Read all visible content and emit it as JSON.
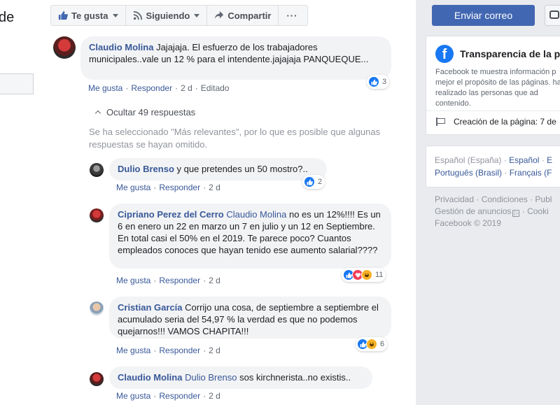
{
  "left": {
    "title_fragment": "de"
  },
  "actions": {
    "like": "Te gusta",
    "follow": "Siguiendo",
    "share": "Compartir",
    "more": "···"
  },
  "header": {
    "send_email": "Enviar correo"
  },
  "comments": [
    {
      "author": "Claudio Molina",
      "mention": "",
      "text": "Jajajaja. El esfuerzo de los trabajadores municipales..vale un 12 % para el intendente.jajajaja PANQUEQUE...",
      "like": "Me gusta",
      "reply": "Responder",
      "time": "2 d",
      "edited": "Editado",
      "reactions": [
        "like"
      ],
      "reaction_count": "3"
    },
    {
      "author": "Dulio Brenso",
      "mention": "",
      "text": "y que pretendes un 50 mostro?..",
      "like": "Me gusta",
      "reply": "Responder",
      "time": "2 d",
      "reactions": [
        "like"
      ],
      "reaction_count": "2"
    },
    {
      "author": "Cipriano Perez del Cerro",
      "mention": "Claudio Molina",
      "text": "no es un 12%!!!! Es un 6 en enero un 22 en marzo un 7 en julio y un 12 en Septiembre. En total casi el 50% en el 2019. Te parece poco? Cuantos empleados conoces que hayan tenido ese aumento salarial????",
      "like": "Me gusta",
      "reply": "Responder",
      "time": "2 d",
      "reactions": [
        "like",
        "love",
        "haha"
      ],
      "reaction_count": "11"
    },
    {
      "author": "Cristian García",
      "mention": "",
      "text": "Corrijo una cosa, de septiembre a septiembre el acumulado seria del 54,97 % la verdad es que no podemos quejarnos!!! VAMOS CHAPITA!!!",
      "like": "Me gusta",
      "reply": "Responder",
      "time": "2 d",
      "reactions": [
        "like",
        "haha"
      ],
      "reaction_count": "6"
    },
    {
      "author": "Claudio Molina",
      "mention": "Dulio Brenso",
      "text": "sos kirchnerista..no existis..",
      "like": "Me gusta",
      "reply": "Responder",
      "time": "2 d",
      "reactions": [],
      "reaction_count": ""
    }
  ],
  "replies": {
    "hide_label": "Ocultar 49 respuestas",
    "notice": "Se ha seleccionado \"Más relevantes\", por lo que es posible que algunas respuestas se hayan omitido."
  },
  "transparency": {
    "title": "Transparencia de la p",
    "description": "Facebook te muestra información p mejor el propósito de las páginas. han realizado las personas que ad contenido.",
    "creation": "Creación de la página: 7 de"
  },
  "languages": {
    "current": "Español (España)",
    "options": [
      "Español",
      "E",
      "Português (Brasil)",
      "Français (F"
    ]
  },
  "footer": {
    "links_row1": [
      "Privacidad",
      "Condiciones",
      "Publ"
    ],
    "links_row2": [
      "Gestión de anuncios",
      "Cooki"
    ],
    "copyright": "Facebook © 2019"
  },
  "colors": {
    "brand_blue": "#4267b2",
    "link_blue": "#385898",
    "like_blue": "#1877f2",
    "love_red": "#f33e58",
    "haha_yellow": "#f7b125"
  }
}
